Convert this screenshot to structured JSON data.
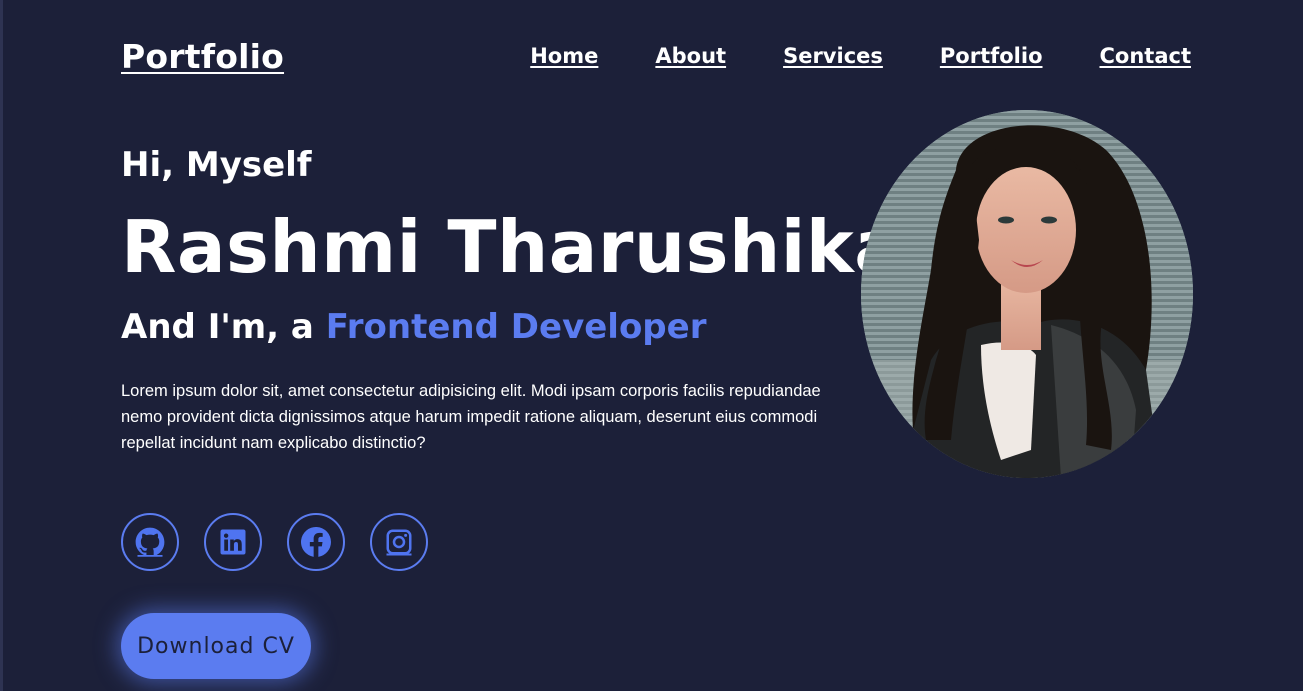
{
  "header": {
    "logo": "Portfolio",
    "nav": [
      "Home",
      "About",
      "Services",
      "Portfolio",
      "Contact"
    ]
  },
  "hero": {
    "greeting": "Hi, Myself",
    "name": "Rashmi Tharushika",
    "role_prefix": "And I'm, a ",
    "role": "Frontend Developer",
    "description": "Lorem ipsum dolor sit, amet consectetur adipisicing elit. Modi ipsam corporis facilis repudiandae nemo provident dicta dignissimos atque harum impedit ratione aliquam, deserunt eius commodi repellat incidunt nam explicabo distinctio?",
    "download_label": "Download CV"
  },
  "socials": [
    "github-icon",
    "linkedin-icon",
    "facebook-icon",
    "instagram-icon"
  ],
  "colors": {
    "background": "#1c2039",
    "accent": "#5b7cf0",
    "text": "#ffffff"
  }
}
